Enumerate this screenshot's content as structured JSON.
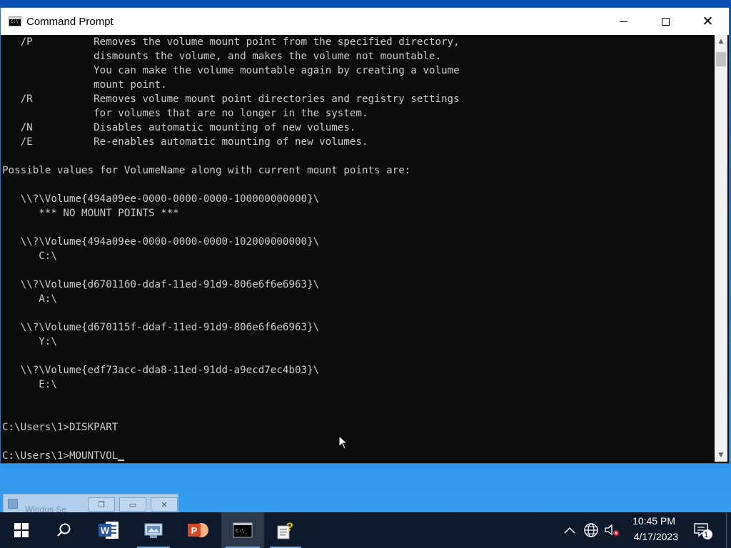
{
  "window": {
    "title": "Command Prompt",
    "app_icon_text": "C:\\"
  },
  "console": {
    "lines": [
      "   /P          Removes the volume mount point from the specified directory,",
      "               dismounts the volume, and makes the volume not mountable.",
      "               You can make the volume mountable again by creating a volume",
      "               mount point.",
      "   /R          Removes volume mount point directories and registry settings",
      "               for volumes that are no longer in the system.",
      "   /N          Disables automatic mounting of new volumes.",
      "   /E          Re-enables automatic mounting of new volumes.",
      "",
      "Possible values for VolumeName along with current mount points are:",
      "",
      "   \\\\?\\Volume{494a09ee-0000-0000-0000-100000000000}\\",
      "      *** NO MOUNT POINTS ***",
      "",
      "   \\\\?\\Volume{494a09ee-0000-0000-0000-102000000000}\\",
      "      C:\\",
      "",
      "   \\\\?\\Volume{d6701160-ddaf-11ed-91d9-806e6f6e6963}\\",
      "      A:\\",
      "",
      "   \\\\?\\Volume{d670115f-ddaf-11ed-91d9-806e6f6e6963}\\",
      "      Y:\\",
      "",
      "   \\\\?\\Volume{edf73acc-dda8-11ed-91dd-a9ecd7ec4b03}\\",
      "      E:\\",
      "",
      "",
      "C:\\Users\\1>DISKPART",
      "",
      "C:\\Users\\1>MOUNTVOL"
    ]
  },
  "minimized_window": {
    "title": "Windos Se"
  },
  "taskbar": {
    "time": "10:45 PM",
    "date": "4/17/2023",
    "notification_count": "1"
  },
  "colors": {
    "console_bg": "#0c0c0c",
    "console_text": "#cccccc",
    "taskbar_bg": "#0e1a2b",
    "desktop_top": "#0a4fb3",
    "word_blue": "#2b579a",
    "powerpoint_orange": "#d24726"
  }
}
